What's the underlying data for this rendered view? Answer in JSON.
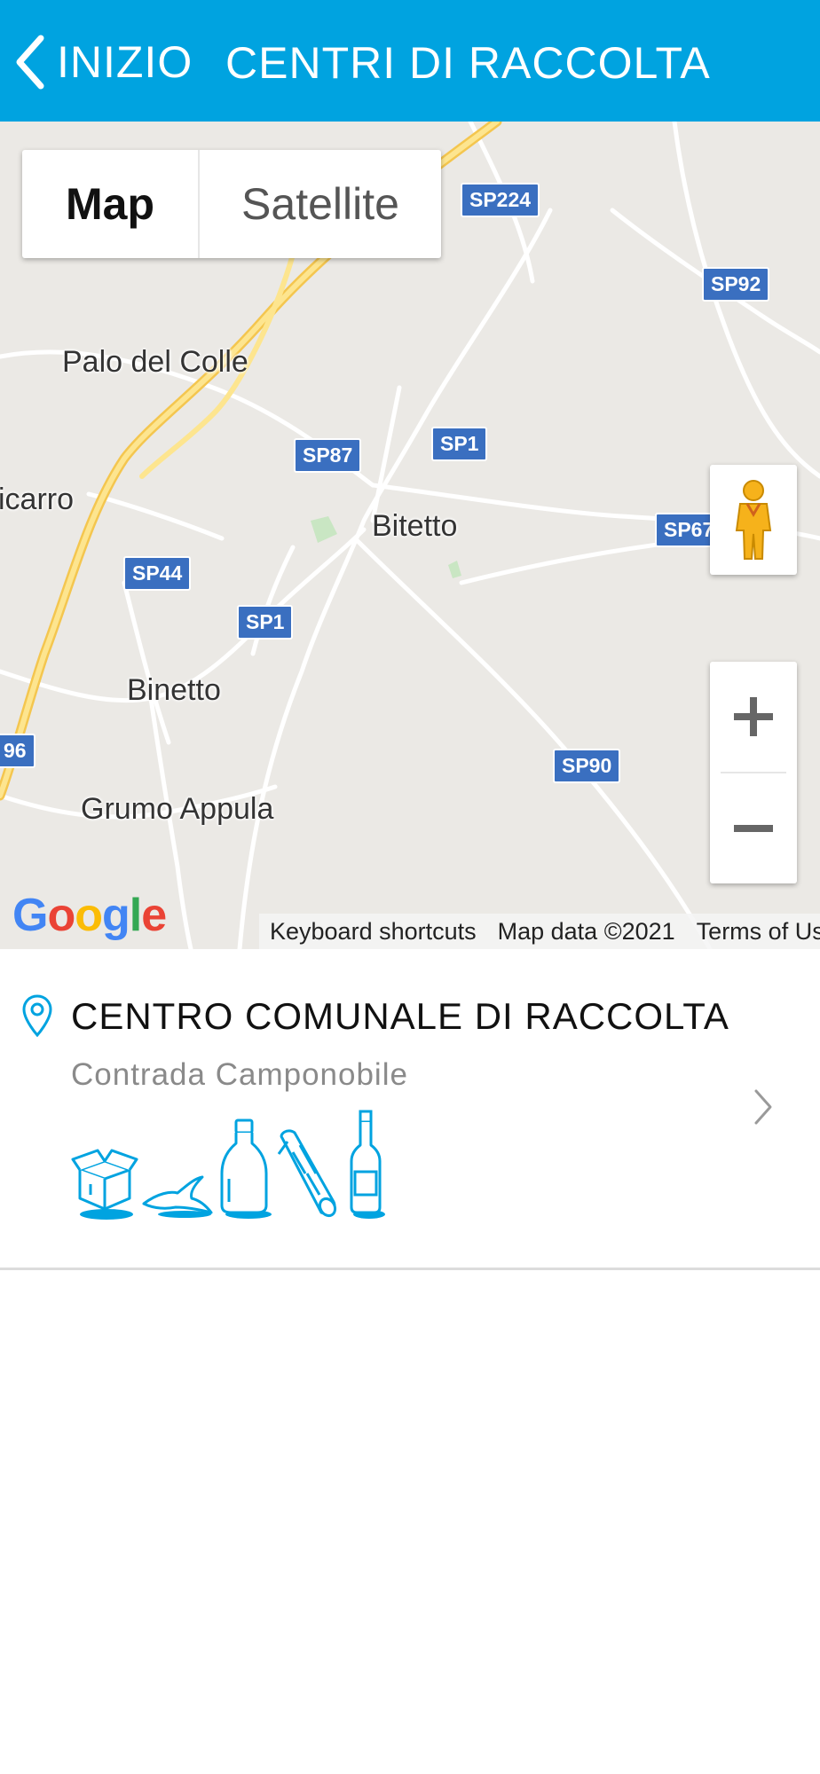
{
  "header": {
    "back_label": "INIZIO",
    "title": "CENTRI DI RACCOLTA",
    "background": "#00a3e0"
  },
  "map": {
    "type_controls": {
      "map": "Map",
      "satellite": "Satellite",
      "selected": "Map"
    },
    "places": [
      "Palo del Colle",
      "icarro",
      "Bitetto",
      "Binetto",
      "Grumo Appula"
    ],
    "road_shields": [
      "SP224",
      "SP92",
      "SP87",
      "SP1",
      "SP67",
      "SP44",
      "SP1",
      "SP90",
      "96"
    ],
    "zoom_in": "+",
    "zoom_out": "−",
    "logo": "Google",
    "attribution": {
      "shortcuts": "Keyboard shortcuts",
      "data": "Map data ©2021",
      "terms": "Terms of Use"
    }
  },
  "results": [
    {
      "title": "CENTRO COMUNALE DI RACCOLTA",
      "subtitle": "Contrada Camponobile",
      "icons": [
        "cardboard-box-icon",
        "banana-peel-icon",
        "plastic-bottle-icon",
        "wood-log-icon",
        "glass-bottle-icon"
      ]
    }
  ],
  "colors": {
    "accent": "#00a3e0",
    "shield": "#3a6fc0",
    "road_major": "#fdd863"
  }
}
